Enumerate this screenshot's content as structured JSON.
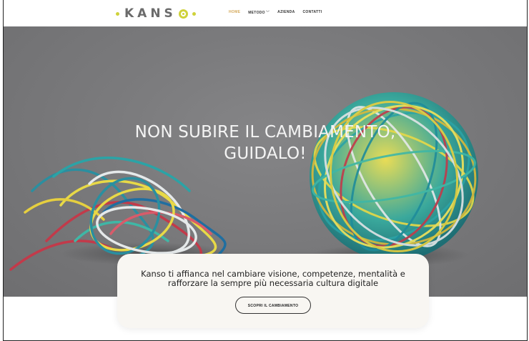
{
  "brand": {
    "logo_text": "KANSO",
    "accent_color": "#cfd23a"
  },
  "nav": {
    "items": [
      {
        "label": "HOME",
        "active": true
      },
      {
        "label": "METODO",
        "dropdown": true
      },
      {
        "label": "AZIENDA"
      },
      {
        "label": "CONTATTI"
      }
    ]
  },
  "hero": {
    "title_line1": "NON SUBIRE IL CAMBIAMENTO,",
    "title_line2": "GUIDALO!"
  },
  "card": {
    "text_line1": "Kanso ti affianca nel cambiare visione, competenze, mentalità e",
    "text_line2": "rafforzare la sempre più necessaria cultura digitale",
    "button_label": "SCOPRI IL CAMBIAMENTO"
  },
  "icons": {
    "dropdown": "chevron-down-icon"
  }
}
